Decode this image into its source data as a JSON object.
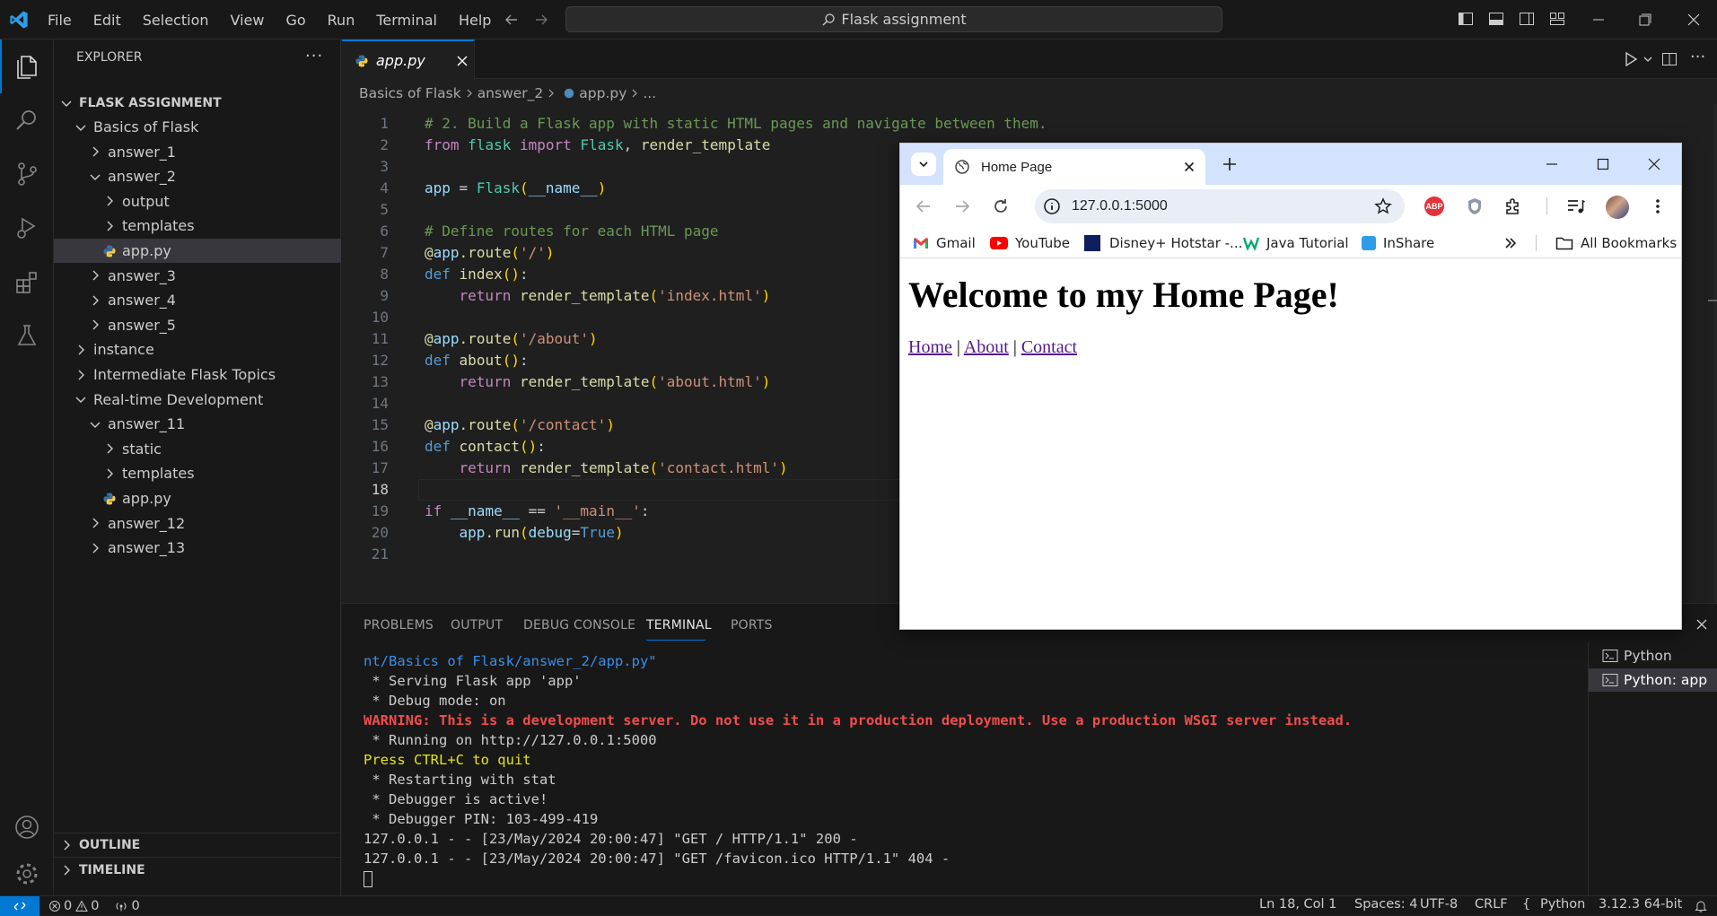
{
  "titlebar": {
    "menu": [
      "File",
      "Edit",
      "Selection",
      "View",
      "Go",
      "Run",
      "Terminal",
      "Help"
    ],
    "search_text": "Flask assignment"
  },
  "explorer": {
    "header": "EXPLORER",
    "root": "FLASK ASSIGNMENT",
    "items": [
      {
        "label": "Basics of Flask",
        "depth": 1,
        "open": true
      },
      {
        "label": "answer_1",
        "depth": 2,
        "open": false
      },
      {
        "label": "answer_2",
        "depth": 2,
        "open": true
      },
      {
        "label": "output",
        "depth": 3,
        "open": false
      },
      {
        "label": "templates",
        "depth": 3,
        "open": false
      },
      {
        "label": "app.py",
        "depth": 3,
        "file": true,
        "selected": true
      },
      {
        "label": "answer_3",
        "depth": 2,
        "open": false
      },
      {
        "label": "answer_4",
        "depth": 2,
        "open": false
      },
      {
        "label": "answer_5",
        "depth": 2,
        "open": false
      },
      {
        "label": "instance",
        "depth": 1,
        "open": false
      },
      {
        "label": "Intermediate Flask Topics",
        "depth": 1,
        "open": false
      },
      {
        "label": "Real-time Development",
        "depth": 1,
        "open": true
      },
      {
        "label": "answer_11",
        "depth": 2,
        "open": true
      },
      {
        "label": "static",
        "depth": 3,
        "open": false
      },
      {
        "label": "templates",
        "depth": 3,
        "open": false
      },
      {
        "label": "app.py",
        "depth": 3,
        "file": true
      },
      {
        "label": "answer_12",
        "depth": 2,
        "open": false
      },
      {
        "label": "answer_13",
        "depth": 2,
        "open": false
      }
    ],
    "outline": "OUTLINE",
    "timeline": "TIMELINE"
  },
  "editor": {
    "tab_label": "app.py",
    "breadcrumb": [
      "Basics of Flask",
      "answer_2",
      "app.py",
      "..."
    ]
  },
  "panel": {
    "tabs": [
      "PROBLEMS",
      "OUTPUT",
      "DEBUG CONSOLE",
      "TERMINAL",
      "PORTS"
    ],
    "terminals": [
      "Python",
      "Python: app"
    ],
    "lines": [
      "nt/Basics of Flask/answer_2/app.py\"",
      " * Serving Flask app 'app'",
      " * Debug mode: on",
      "WARNING: This is a development server. Do not use it in a production deployment. Use a production WSGI server instead.",
      " * Running on http://127.0.0.1:5000",
      "Press CTRL+C to quit",
      " * Restarting with stat",
      " * Debugger is active!",
      " * Debugger PIN: 103-499-419",
      "127.0.0.1 - - [23/May/2024 20:00:47] \"GET / HTTP/1.1\" 200 -",
      "127.0.0.1 - - [23/May/2024 20:00:47] \"GET /favicon.ico HTTP/1.1\" 404 -"
    ]
  },
  "status": {
    "errors": "0",
    "warnings": "0",
    "ports": "0",
    "position": "Ln 18, Col 1",
    "spaces": "Spaces: 4",
    "encoding": "UTF-8",
    "eol": "CRLF",
    "language": "Python",
    "interpreter": "3.12.3 64-bit"
  },
  "browser": {
    "tab_title": "Home Page",
    "url": "127.0.0.1:5000",
    "bookmarks": [
      "Gmail",
      "YouTube",
      "Disney+ Hotstar -...",
      "Java Tutorial",
      "InShare"
    ],
    "all_bookmarks": "All Bookmarks",
    "abp": "ABP",
    "heading": "Welcome to my Home Page!",
    "nav": [
      "Home",
      "About",
      "Contact"
    ],
    "sep": "|"
  },
  "colors": {
    "accent": "#0078d4",
    "warning_text": "#f14c4c",
    "yellow_text": "#e5e510",
    "link": "#551a8b"
  }
}
